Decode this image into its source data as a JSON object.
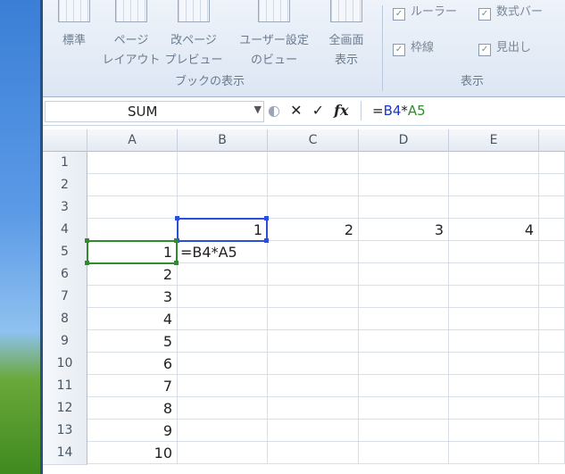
{
  "ribbon": {
    "buttons": [
      {
        "l1": "標準",
        "l2": ""
      },
      {
        "l1": "ページ",
        "l2": "レイアウト"
      },
      {
        "l1": "改ページ",
        "l2": "プレビュー"
      },
      {
        "l1": "ユーザー設定",
        "l2": "のビュー"
      },
      {
        "l1": "全画面",
        "l2": "表示"
      }
    ],
    "group_book_view": "ブックの表示",
    "group_show": "表示",
    "checks": [
      {
        "label": "ルーラー",
        "checked": true
      },
      {
        "label": "数式バー",
        "checked": true
      },
      {
        "label": "枠線",
        "checked": true
      },
      {
        "label": "見出し",
        "checked": true
      }
    ]
  },
  "formula_bar": {
    "name_box": "SUM",
    "formula_prefix": "=",
    "formula_ref1": "B4",
    "formula_op": "*",
    "formula_ref2": "A5",
    "cancel": "✕",
    "enter": "✓",
    "fx": "fx"
  },
  "sheet": {
    "columns": [
      "A",
      "B",
      "C",
      "D",
      "E"
    ],
    "rows": [
      "1",
      "2",
      "3",
      "4",
      "5",
      "6",
      "7",
      "8",
      "9",
      "10",
      "11",
      "12",
      "13",
      "14"
    ],
    "row4": {
      "B": "1",
      "C": "2",
      "D": "3",
      "E": "4"
    },
    "col_a": {
      "5": "1",
      "6": "2",
      "7": "3",
      "8": "4",
      "9": "5",
      "10": "6",
      "11": "7",
      "12": "8",
      "13": "9",
      "14": "10"
    },
    "editing_cell_b5": "=B4*A5"
  },
  "colors": {
    "ref_b4": "#1a35c8",
    "ref_a5": "#2e8b2e"
  }
}
